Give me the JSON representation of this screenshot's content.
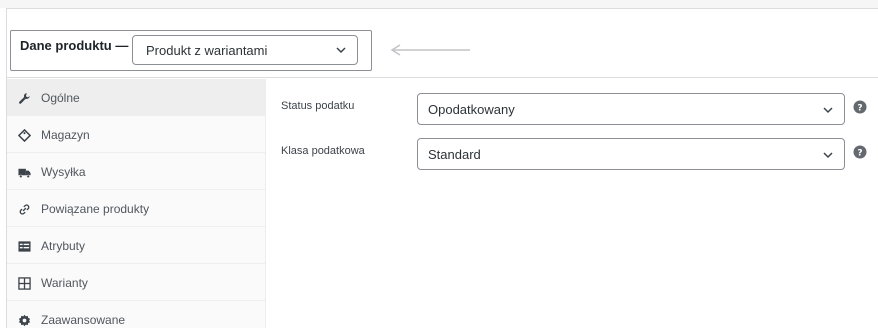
{
  "product_data": {
    "title": "Dane produktu —",
    "product_type": "Produkt z wariantami"
  },
  "tabs": [
    {
      "label": "Ogólne",
      "icon": "wrench-icon",
      "active": true
    },
    {
      "label": "Magazyn",
      "icon": "tag-icon",
      "active": false
    },
    {
      "label": "Wysyłka",
      "icon": "truck-icon",
      "active": false
    },
    {
      "label": "Powiązane produkty",
      "icon": "link-icon",
      "active": false
    },
    {
      "label": "Atrybuty",
      "icon": "list-icon",
      "active": false
    },
    {
      "label": "Warianty",
      "icon": "grid-icon",
      "active": false
    },
    {
      "label": "Zaawansowane",
      "icon": "gear-icon",
      "active": false
    }
  ],
  "fields": {
    "tax_status": {
      "label": "Status podatku",
      "value": "Opodatkowany"
    },
    "tax_class": {
      "label": "Klasa podatkowa",
      "value": "Standard"
    }
  },
  "colors": {
    "border": "#dcdcde",
    "active_tab": "#eeeeee",
    "text": "#3c434a",
    "help_icon": "#646970"
  }
}
